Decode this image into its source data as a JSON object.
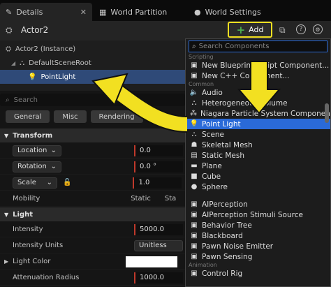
{
  "tabs": [
    {
      "label": "Details"
    },
    {
      "label": "World Partition"
    },
    {
      "label": "World Settings"
    }
  ],
  "actor_name": "Actor2",
  "add_button": {
    "label": "Add"
  },
  "tree": {
    "items": [
      {
        "label": "Actor2 (Instance)"
      },
      {
        "label": "DefaultSceneRoot"
      },
      {
        "label": "PointLight"
      }
    ]
  },
  "search_placeholder": "Search",
  "filters": [
    "General",
    "Misc",
    "Rendering"
  ],
  "sections": {
    "transform": "Transform",
    "light": "Light"
  },
  "transform_rows": [
    {
      "label": "Location",
      "value": "0.0"
    },
    {
      "label": "Rotation",
      "value": "0.0 °"
    },
    {
      "label": "Scale",
      "value": "1.0"
    }
  ],
  "mobility": {
    "label": "Mobility",
    "options": [
      "Static",
      "Sta"
    ]
  },
  "light_rows": [
    {
      "label": "Intensity",
      "value": "5000.0"
    },
    {
      "label": "Intensity Units",
      "value": "Unitless"
    },
    {
      "label": "Light Color",
      "value": ""
    },
    {
      "label": "Attenuation Radius",
      "value": "1000.0"
    }
  ],
  "menu": {
    "search_placeholder": "Search Components",
    "headers": {
      "scripting": "Scripting",
      "common": "Common",
      "animation": "Animation"
    },
    "scripting_items": [
      {
        "label": "New Blueprint Script Component..."
      },
      {
        "label": "New C++ Component..."
      }
    ],
    "common_items": [
      {
        "label": "Audio"
      },
      {
        "label": "Heterogeneous Volume"
      },
      {
        "label": "Niagara Particle System Component"
      },
      {
        "label": "Point Light"
      },
      {
        "label": "Scene"
      },
      {
        "label": "Skeletal Mesh"
      },
      {
        "label": "Static Mesh"
      },
      {
        "label": "Plane"
      },
      {
        "label": "Cube"
      },
      {
        "label": "Sphere"
      }
    ],
    "ai_items": [
      {
        "label": "AIPerception"
      },
      {
        "label": "AIPerception Stimuli Source"
      },
      {
        "label": "Behavior Tree"
      },
      {
        "label": "Blackboard"
      },
      {
        "label": "Pawn Noise Emitter"
      },
      {
        "label": "Pawn Sensing"
      }
    ],
    "animation_items": [
      {
        "label": "Control Rig"
      }
    ]
  },
  "colors": {
    "accent": "#f2e021",
    "highlight": "#2a6ad8",
    "selection": "#2f4a78",
    "plus": "#4caf50"
  }
}
